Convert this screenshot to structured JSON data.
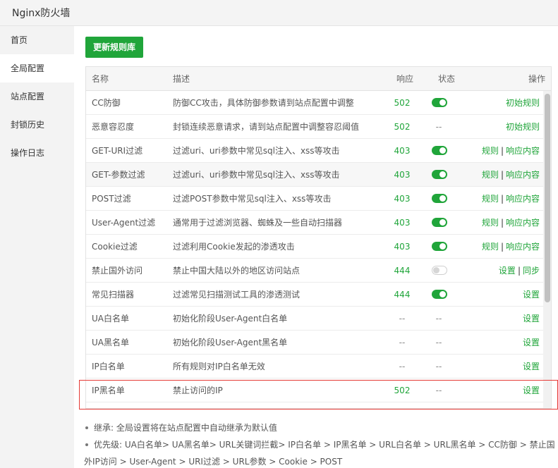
{
  "window": {
    "title": "Nginx防火墙"
  },
  "sidebar": {
    "items": [
      {
        "label": "首页",
        "active": false
      },
      {
        "label": "全局配置",
        "active": true
      },
      {
        "label": "站点配置",
        "active": false
      },
      {
        "label": "封锁历史",
        "active": false
      },
      {
        "label": "操作日志",
        "active": false
      }
    ]
  },
  "toolbar": {
    "update_button": "更新规则库"
  },
  "table": {
    "headers": {
      "name": "名称",
      "desc": "描述",
      "response": "响应",
      "state": "状态",
      "ops": "操作"
    },
    "rows": [
      {
        "name": "CC防御",
        "desc": "防御CC攻击，具体防御参数请到站点配置中调整",
        "response": "502",
        "state": "on",
        "ops": [
          "初始规则"
        ]
      },
      {
        "name": "恶意容忍度",
        "desc": "封锁连续恶意请求，请到站点配置中调整容忍阈值",
        "response": "502",
        "state": "--",
        "ops": [
          "初始规则"
        ]
      },
      {
        "name": "GET-URI过滤",
        "desc": "过滤uri、uri参数中常见sql注入、xss等攻击",
        "response": "403",
        "state": "on",
        "ops": [
          "规则",
          "响应内容"
        ]
      },
      {
        "name": "GET-参数过滤",
        "desc": "过滤uri、uri参数中常见sql注入、xss等攻击",
        "response": "403",
        "state": "on",
        "ops": [
          "规则",
          "响应内容"
        ]
      },
      {
        "name": "POST过滤",
        "desc": "过滤POST参数中常见sql注入、xss等攻击",
        "response": "403",
        "state": "on",
        "ops": [
          "规则",
          "响应内容"
        ]
      },
      {
        "name": "User-Agent过滤",
        "desc": "通常用于过滤浏览器、蜘蛛及一些自动扫描器",
        "response": "403",
        "state": "on",
        "ops": [
          "规则",
          "响应内容"
        ]
      },
      {
        "name": "Cookie过滤",
        "desc": "过滤利用Cookie发起的渗透攻击",
        "response": "403",
        "state": "on",
        "ops": [
          "规则",
          "响应内容"
        ]
      },
      {
        "name": "禁止国外访问",
        "desc": "禁止中国大陆以外的地区访问站点",
        "response": "444",
        "state": "off",
        "ops": [
          "设置",
          "同步"
        ]
      },
      {
        "name": "常见扫描器",
        "desc": "过滤常见扫描测试工具的渗透测试",
        "response": "444",
        "state": "on",
        "ops": [
          "设置"
        ]
      },
      {
        "name": "UA白名单",
        "desc": "初始化阶段User-Agent白名单",
        "response": "--",
        "state": "--",
        "ops": [
          "设置"
        ]
      },
      {
        "name": "UA黑名单",
        "desc": "初始化阶段User-Agent黑名单",
        "response": "--",
        "state": "--",
        "ops": [
          "设置"
        ]
      },
      {
        "name": "IP白名单",
        "desc": "所有规则对IP白名单无效",
        "response": "--",
        "state": "--",
        "ops": [
          "设置"
        ]
      },
      {
        "name": "IP黑名单",
        "desc": "禁止访问的IP",
        "response": "502",
        "state": "--",
        "ops": [
          "设置"
        ]
      }
    ]
  },
  "notes": [
    {
      "text": "继承: 全局设置将在站点配置中自动继承为默认值"
    },
    {
      "text": "优先级: UA白名单> UA黑名单> URL关键词拦截> IP白名单 > IP黑名单 > URL白名单 > URL黑名单 > CC防御 > 禁止国",
      "cont": "外IP访问 > User-Agent > URI过滤 > URL参数 > Cookie > POST"
    }
  ],
  "colors": {
    "accent": "#20a53a",
    "highlight": "#e53935"
  }
}
